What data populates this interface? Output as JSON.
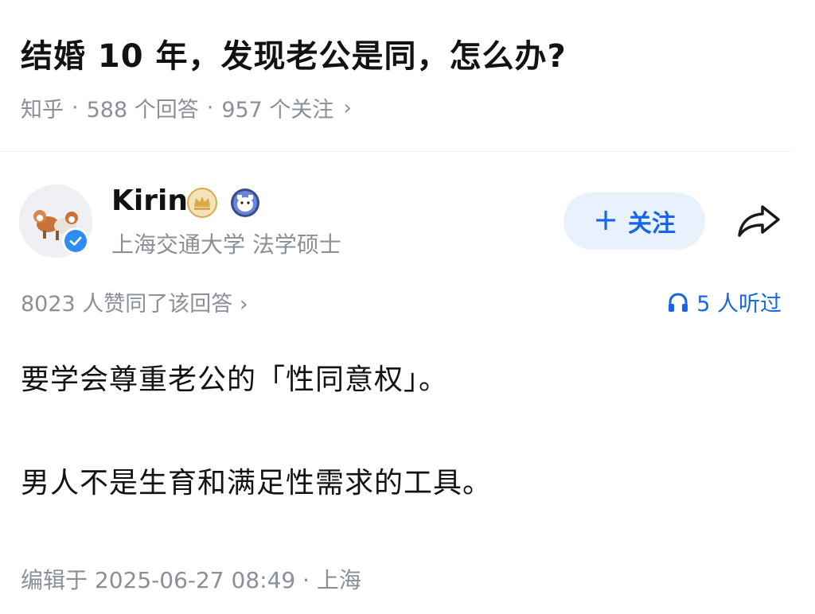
{
  "question": {
    "title": "结婚 10 年，发现老公是同，怎么办?",
    "meta": {
      "source": "知乎",
      "answers": "588 个回答",
      "followers": "957 个关注"
    }
  },
  "author": {
    "name": "Kirin",
    "bio": "上海交通大学 法学硕士",
    "badges": [
      "crown-badge-icon",
      "mascot-badge-icon"
    ],
    "verified_color": "#2f8cf5"
  },
  "actions": {
    "follow_label": "关注",
    "share_icon": "share-arrow-icon"
  },
  "stats": {
    "votes": "8023 人赞同了该回答 ›",
    "listens": "5 人听过"
  },
  "answer": {
    "paragraphs": [
      "要学会尊重老公的「性同意权」。",
      "男人不是生育和满足性需求的工具。"
    ]
  },
  "footer": {
    "edited": "编辑于 2025-06-27 08:49 · 上海"
  },
  "colors": {
    "accent": "#1766e6",
    "muted_text": "#8a8f99",
    "follow_bg": "#e9f1fd"
  }
}
